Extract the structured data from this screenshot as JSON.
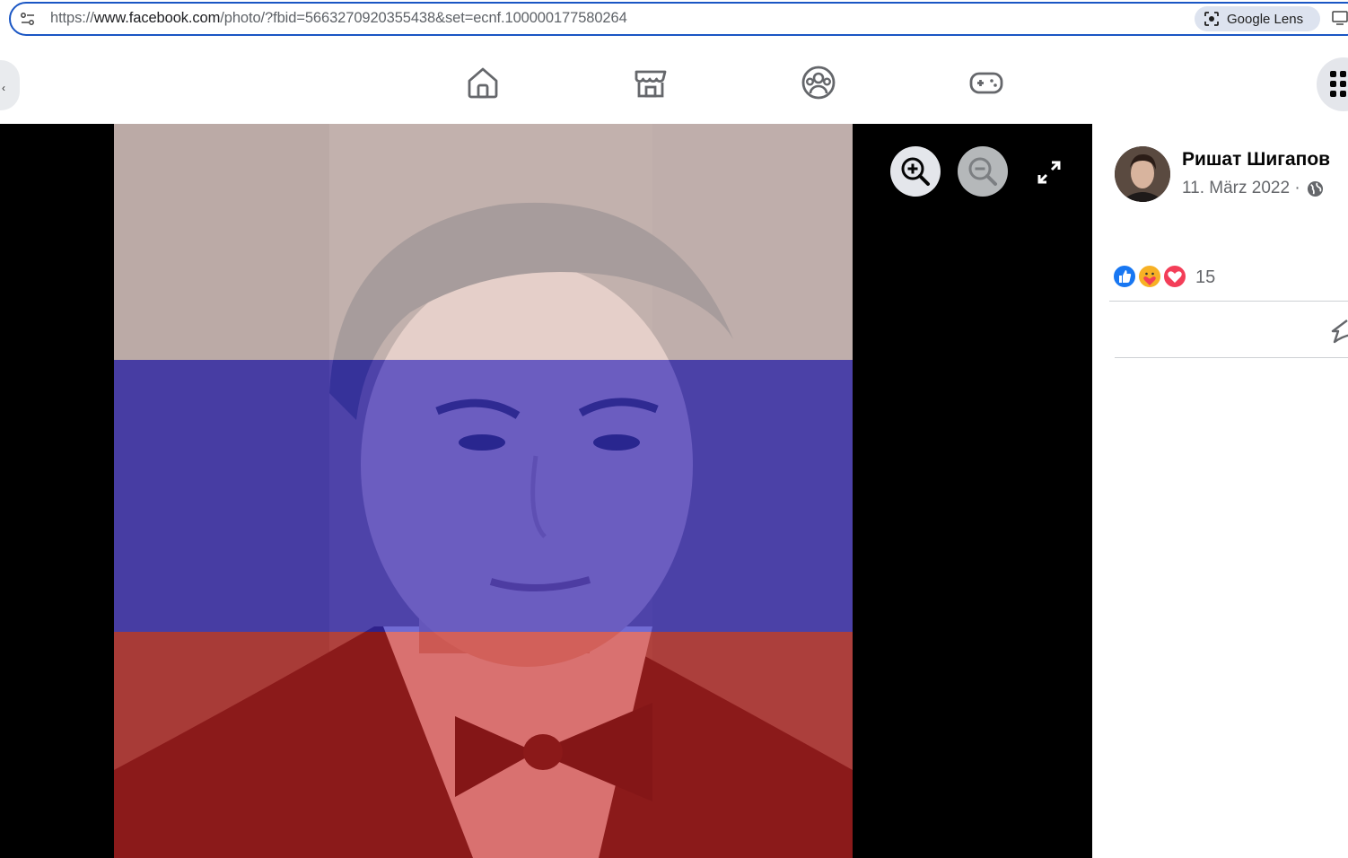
{
  "browser": {
    "url_prefix": "https://",
    "url_main": "www.facebook.com",
    "url_rest": "/photo/?fbid=5663270920355438&set=ecnf.100000177580264",
    "lens_label": "Google Lens"
  },
  "nav": {
    "left_button_glyph": "‹",
    "icons": [
      "home-icon",
      "marketplace-icon",
      "groups-icon",
      "gaming-icon"
    ]
  },
  "post": {
    "author": "Ришат Шигапов",
    "date": "11. März 2022 ·",
    "privacy_icon": "globe-icon",
    "reaction_count": "15",
    "reactions": [
      "like",
      "care",
      "love"
    ]
  },
  "colors": {
    "fb_blue": "#1877f2",
    "love_red": "#f33e58",
    "care_yellow": "#f7b125",
    "flag_white": "#ffffff",
    "flag_blue": "#0039a6",
    "flag_red": "#d52b1e"
  }
}
